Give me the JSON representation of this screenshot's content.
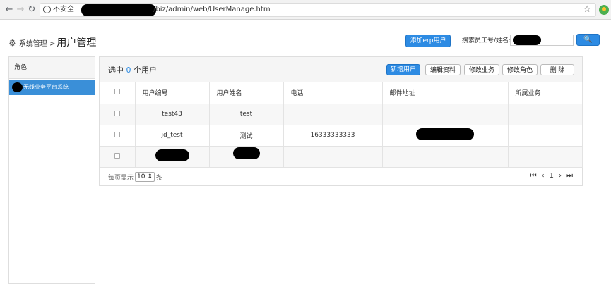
{
  "browser": {
    "back_icon": "←",
    "forward_icon": "→",
    "reload_icon": "↻",
    "insecure_label": "不安全",
    "url_path": "/biz/admin/web/UserManage.htm",
    "star_icon": "☆"
  },
  "header": {
    "gear_icon": "⚙",
    "breadcrumb": "系统管理 >",
    "title": "用户管理",
    "add_erp_label": "添加erp用户",
    "search_label": "搜索员工号/姓名:",
    "search_icon": "🔍"
  },
  "sidebar": {
    "heading": "角色",
    "items": [
      {
        "label": "无线业务平台系统"
      }
    ]
  },
  "panel": {
    "selected_prefix": "选中",
    "selected_count": "0",
    "selected_suffix": "个用户",
    "buttons": {
      "new_user": "新增用户",
      "edit_info": "编辑资料",
      "modify_business": "修改业务",
      "modify_role": "修改角色",
      "delete": "删 除"
    }
  },
  "table": {
    "columns": [
      "用户编号",
      "用户姓名",
      "电话",
      "邮件地址",
      "所属业务"
    ],
    "rows": [
      {
        "id": "test43",
        "name": "test",
        "phone": "",
        "email": "",
        "business": ""
      },
      {
        "id": "jd_test",
        "name": "测试",
        "phone": "16333333333",
        "email": "",
        "business": ""
      },
      {
        "id": "",
        "name": "",
        "phone": "",
        "email": "",
        "business": ""
      }
    ]
  },
  "pager": {
    "per_page_label": "每页显示",
    "page_size": "10 ⇕",
    "unit": "条",
    "first_icon": "⏮",
    "prev_icon": "‹",
    "current_page": "1",
    "next_icon": "›",
    "last_icon": "⏭"
  }
}
